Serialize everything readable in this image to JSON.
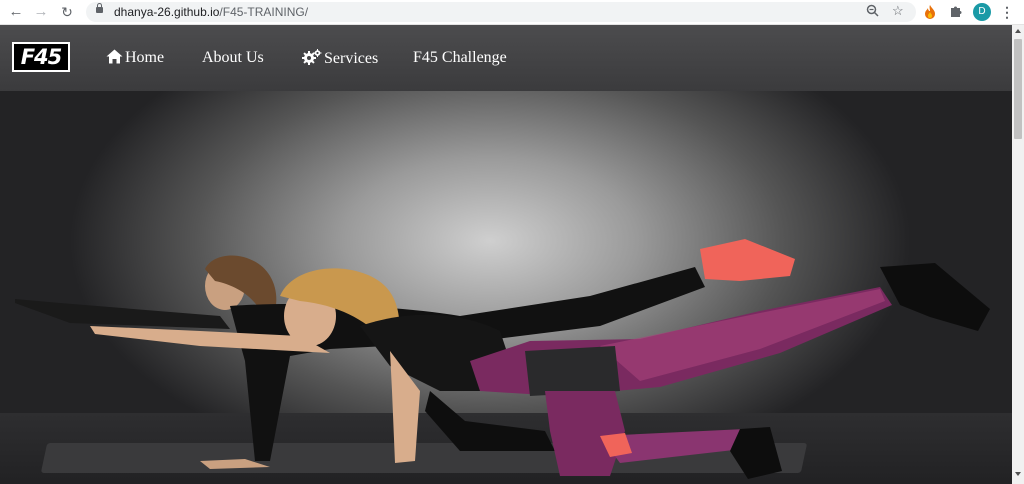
{
  "browser": {
    "url_host": "dhanya-26.github.io",
    "url_path": "/F45-TRAINING/",
    "profile_initial": "D"
  },
  "site": {
    "logo_text": "F45",
    "nav": [
      {
        "label": "Home",
        "icon": "home-icon"
      },
      {
        "label": "About Us",
        "icon": null
      },
      {
        "label": "Services",
        "icon": "gears-icon"
      },
      {
        "label": "F45 Challenge",
        "icon": null
      }
    ]
  },
  "hero": {
    "image": "two-women-doing-bird-dog-exercise-on-mat",
    "colors": {
      "backdrop": "#9a9a9a",
      "navbar": "#444446",
      "accent_shoe": "#f0645a",
      "leggings": "#8a2a6a"
    }
  }
}
